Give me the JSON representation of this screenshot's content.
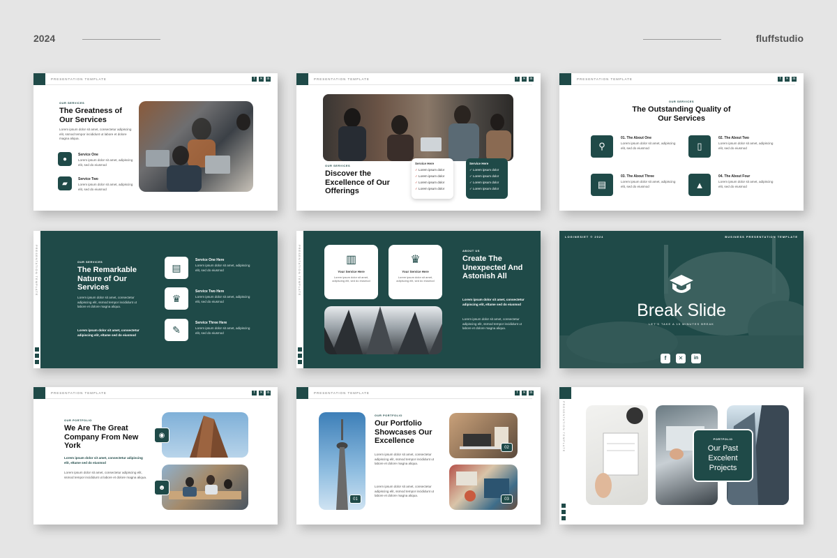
{
  "header": {
    "year": "2024",
    "brand": "fluffstudio"
  },
  "common": {
    "template_label": "PRESENTATION TEMPLATE",
    "lorem": "Lorem ipsum dolor sit amet, consectetur adipiscing elit, ssmod tempor incididunt ut labore et dolore magna aliqua.",
    "lorem_short": "Lorem ipsum dolor sit amet, adipiscing elit, sed do eiusmod",
    "lorem_bold": "Lorem ipsum dolor sit amet, consectetur adipiscing elit, eltame sed do eiusmod"
  },
  "s1": {
    "kicker": "OUR SERVICES",
    "title": "The Greatness of Our Services",
    "item1": "Service One",
    "item2": "Service Two"
  },
  "s2": {
    "kicker": "OUR SERVICES",
    "title": "Discover the Excellence of Our Offerings",
    "card_title": "Service Here",
    "items": [
      "Lorem ipsum dolor",
      "Lorem ipsum dolor",
      "Lorem ipsum dolor",
      "Lorem ipsum dolor"
    ]
  },
  "s3": {
    "kicker": "OUR SERVICES",
    "title": "The Outstanding Quality of Our Services",
    "i1": "01. The About One",
    "i2": "02. The About Two",
    "i3": "03. The About Three",
    "i4": "04. The About Four"
  },
  "s4": {
    "kicker": "OUR SERVICES",
    "title": "The Remarkable Nature of Our Services",
    "i1": "Service One Here",
    "i2": "Service Two Here",
    "i3": "Service Three Here"
  },
  "s5": {
    "kicker": "ABOUT US",
    "title": "Create The Unexpected And Astonish All",
    "card": "Your Service Here"
  },
  "s6": {
    "top_left": "LOGINESIET © 2024",
    "top_right": "BUSINESS PRESENTATION TEMPLATE",
    "title": "Break Slide",
    "subtitle": "LET'S TAKE A 15 MINUTES BREAK"
  },
  "s7": {
    "kicker": "OUR PORTFOLIO",
    "title": "We Are The Great Company From New York"
  },
  "s8": {
    "kicker": "OUR PORTFOLIO",
    "title": "Our Portfolio Showcases Our Excellence",
    "n1": "01",
    "n2": "02",
    "n3": "03"
  },
  "s9": {
    "kicker": "PORTFOLIO",
    "title": "Our Past Excelent Projects"
  },
  "icons": {
    "facebook": "f",
    "x": "✕",
    "linkedin": "in"
  }
}
